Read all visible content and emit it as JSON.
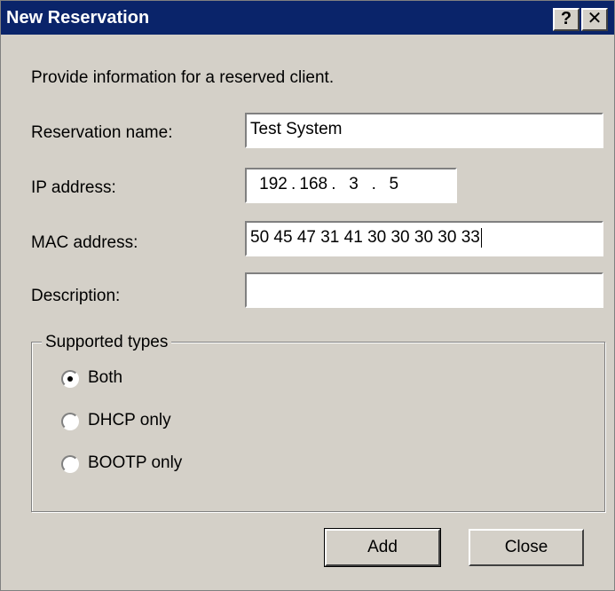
{
  "window": {
    "title": "New Reservation",
    "help_glyph": "?",
    "close_glyph": "✕"
  },
  "intro": "Provide information for a reserved client.",
  "fields": {
    "reservation_name": {
      "label": "Reservation name:",
      "value": "Test System"
    },
    "ip_address": {
      "label": "IP address:",
      "octets": [
        "192",
        "168",
        "3",
        "5"
      ],
      "sep": "."
    },
    "mac_address": {
      "label": "MAC address:",
      "value": "50 45 47 31 41 30 30 30 30 33"
    },
    "description": {
      "label": "Description:",
      "value": ""
    }
  },
  "supported_types": {
    "legend": "Supported types",
    "options": [
      {
        "label": "Both",
        "selected": true
      },
      {
        "label": "DHCP only",
        "selected": false
      },
      {
        "label": "BOOTP only",
        "selected": false
      }
    ]
  },
  "buttons": {
    "add": "Add",
    "close": "Close"
  }
}
